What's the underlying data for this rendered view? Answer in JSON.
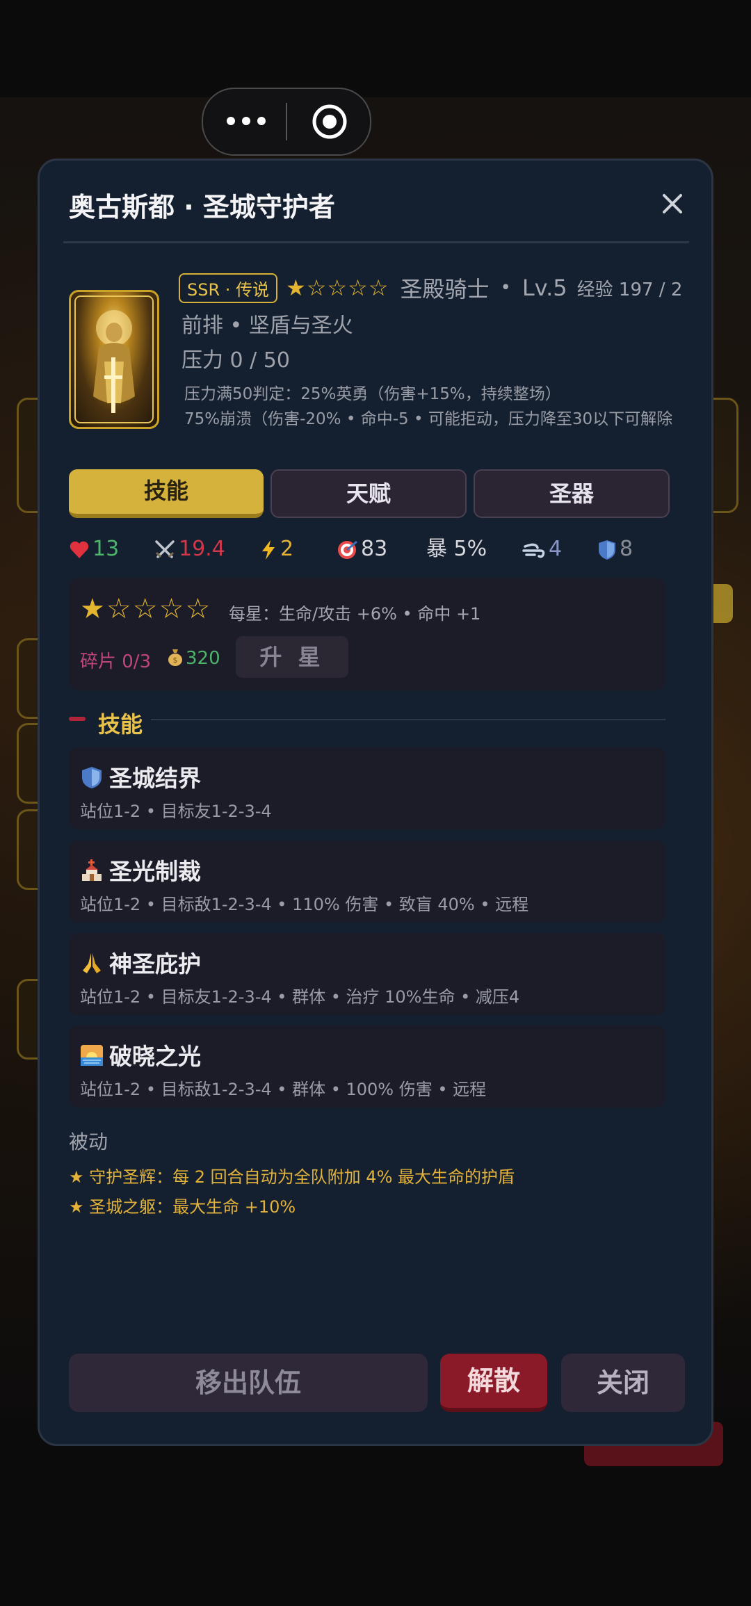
{
  "modal": {
    "title": "奥古斯都 · 圣城守护者"
  },
  "hero": {
    "rarity": "SSR · 传说",
    "stars": "★☆☆☆☆",
    "star_rating": 1,
    "class": "圣殿骑士",
    "separator": "•",
    "level": "Lv.5",
    "exp": "经验 197 / 2",
    "line2": "前排 • 坚盾与圣火",
    "pressure": "压力 0 / 50",
    "pressure_note_1": "压力满50判定：25%英勇（伤害+15%，持续整场）",
    "pressure_note_2": "75%崩溃（伤害-20% • 命中-5 • 可能拒动，压力降至30以下可解除"
  },
  "tabs": [
    {
      "label": "技能",
      "active": true
    },
    {
      "label": "天赋",
      "active": false
    },
    {
      "label": "圣器",
      "active": false
    }
  ],
  "stats": {
    "hp": "13",
    "atk": "19.4",
    "speed": "2",
    "accuracy": "83",
    "crit": "暴 5%",
    "dodge": "4",
    "defense": "8"
  },
  "upgrade": {
    "stars": "★☆☆☆☆",
    "per_star": "每星：生命/攻击 +6% • 命中 +1",
    "fragments": "碎片 0/3",
    "gold": "320",
    "button": "升 星"
  },
  "section": {
    "title": "技能"
  },
  "skills": [
    {
      "icon": "shield-icon",
      "name": "圣城结界",
      "desc": "站位1-2 • 目标友1-2-3-4"
    },
    {
      "icon": "church-icon",
      "name": "圣光制裁",
      "desc": "站位1-2 • 目标敌1-2-3-4 • 110% 伤害 • 致盲 40% • 远程"
    },
    {
      "icon": "praying-hands-icon",
      "name": "神圣庇护",
      "desc": "站位1-2 • 目标友1-2-3-4 • 群体 • 治疗 10%生命 • 减压4"
    },
    {
      "icon": "sunrise-icon",
      "name": "破晓之光",
      "desc": "站位1-2 • 目标敌1-2-3-4 • 群体 • 100% 伤害 • 远程"
    }
  ],
  "passive": {
    "title": "被动",
    "items": [
      "★ 守护圣辉：每 2 回合自动为全队附加 4% 最大生命的护盾",
      "★ 圣城之躯：最大生命 +10%"
    ]
  },
  "buttons": {
    "leave": "移出队伍",
    "disband": "解散",
    "close": "关闭"
  },
  "colors": {
    "modal_bg": "#142030",
    "gold": "#d4b23c",
    "danger": "#8a1a28",
    "hp": "#4cb56a",
    "atk": "#d0384a"
  }
}
